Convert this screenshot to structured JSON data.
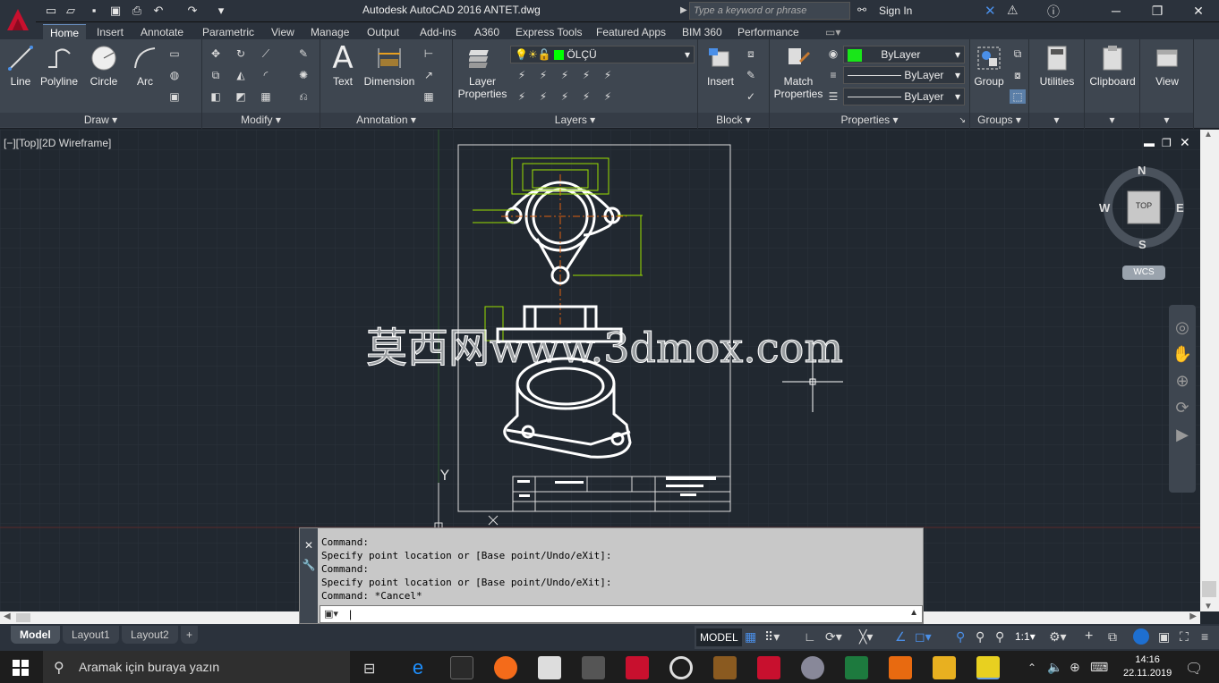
{
  "app": {
    "title": "Autodesk AutoCAD 2016    ANTET.dwg",
    "search_placeholder": "Type a keyword or phrase",
    "signin": "Sign In",
    "logo_letter": "A"
  },
  "tabs": [
    "Home",
    "Insert",
    "Annotate",
    "Parametric",
    "View",
    "Manage",
    "Output",
    "Add-ins",
    "A360",
    "Express Tools",
    "Featured Apps",
    "BIM 360",
    "Performance"
  ],
  "ribbon": {
    "draw": {
      "title": "Draw",
      "buttons": [
        "Line",
        "Polyline",
        "Circle",
        "Arc"
      ]
    },
    "modify": {
      "title": "Modify"
    },
    "annotation": {
      "title": "Annotation",
      "buttons": [
        "Text",
        "Dimension"
      ]
    },
    "layers": {
      "title": "Layers",
      "button": "Layer Properties",
      "current_layer": "ÖLÇÜ"
    },
    "block": {
      "title": "Block",
      "button": "Insert"
    },
    "properties": {
      "title": "Properties",
      "button": "Match Properties",
      "color": "ByLayer",
      "linetype": "ByLayer",
      "lineweight": "ByLayer"
    },
    "groups": {
      "title": "Groups",
      "button": "Group"
    },
    "utilities": {
      "label": "Utilities"
    },
    "clipboard": {
      "label": "Clipboard"
    },
    "view": {
      "label": "View"
    }
  },
  "viewport": {
    "label": "[−][Top][2D Wireframe]",
    "watermark": "莫西网www.3dmox.com",
    "viewcube": {
      "top": "TOP",
      "n": "N",
      "s": "S",
      "e": "E",
      "w": "W",
      "wcs": "WCS"
    },
    "ucs_y": "Y"
  },
  "command": {
    "history": [
      "Command:",
      "Specify point location or [Base point/Undo/eXit]:",
      "Command:",
      "Specify point location or [Base point/Undo/eXit]:",
      "Command: *Cancel*"
    ]
  },
  "layouts": [
    "Model",
    "Layout1",
    "Layout2",
    "+"
  ],
  "status": {
    "model": "MODEL",
    "scale": "1:1"
  },
  "taskbar": {
    "search": "Aramak için buraya yazın",
    "time": "14:16",
    "date": "22.11.2019"
  },
  "colors": {
    "accent": "#c8102e",
    "bylayer_green": "#19e619",
    "layer_green": "#00ff00",
    "dim_green": "#9be000",
    "center_orange": "#e06010"
  }
}
